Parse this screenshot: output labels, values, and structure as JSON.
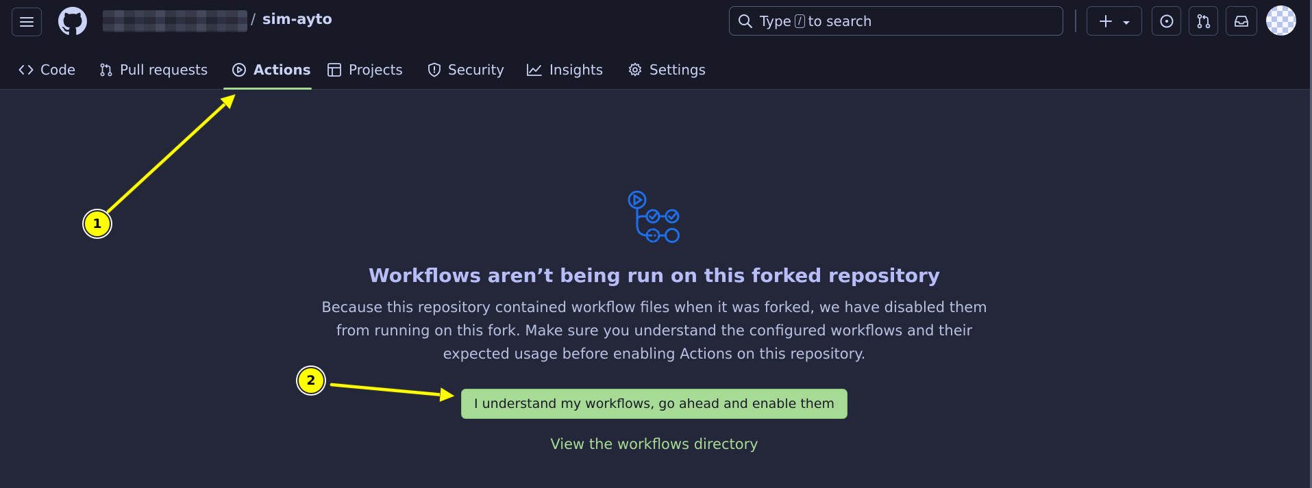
{
  "header": {
    "menu_icon": "hamburger-icon",
    "logo_icon": "github-logo",
    "owner_text": "",
    "separator": "/",
    "repo_name": "sim-ayto",
    "search": {
      "prefix": "Type",
      "shortcut": "/",
      "suffix": "to search"
    },
    "actions": [
      "plus-icon",
      "chevron-down-icon",
      "issues-icon",
      "pull-request-icon",
      "inbox-icon",
      "avatar"
    ]
  },
  "tabs": [
    {
      "label": "Code",
      "icon": "code-icon"
    },
    {
      "label": "Pull requests",
      "icon": "pull-request-icon"
    },
    {
      "label": "Actions",
      "icon": "play-icon",
      "active": true
    },
    {
      "label": "Projects",
      "icon": "table-icon"
    },
    {
      "label": "Security",
      "icon": "shield-icon"
    },
    {
      "label": "Insights",
      "icon": "graph-icon"
    },
    {
      "label": "Settings",
      "icon": "gear-icon"
    }
  ],
  "blankslate": {
    "icon": "workflow-icon",
    "title": "Workflows aren’t being run on this forked repository",
    "description": "Because this repository contained workflow files when it was forked, we have disabled them from running on this fork. Make sure you understand the configured workflows and their expected usage before enabling Actions on this repository.",
    "button_label": "I understand my workflows, go ahead and enable them",
    "link_label": "View the workflows directory"
  },
  "annotations": [
    {
      "number": "1",
      "color": "#ffff00"
    },
    {
      "number": "2",
      "color": "#ffff00"
    }
  ],
  "colors": {
    "background": "#24273a",
    "header_background": "#181926",
    "accent_green": "#a6da95",
    "title_lavender": "#b7bdf8",
    "workflow_icon_blue": "#1f6feb"
  }
}
